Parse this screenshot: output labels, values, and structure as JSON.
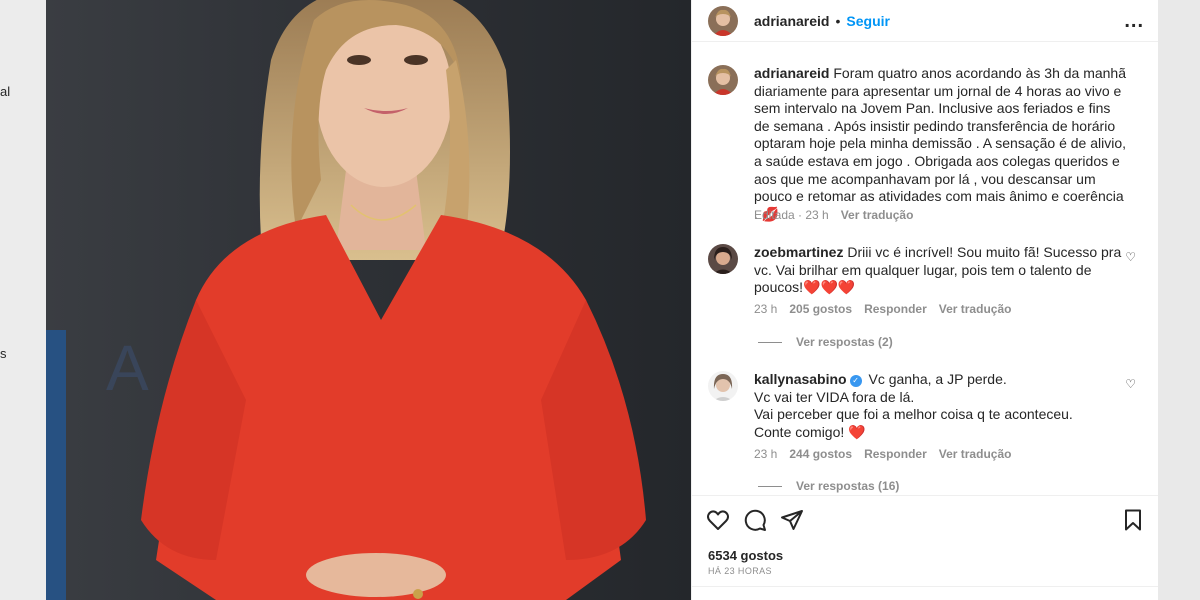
{
  "gutter_left": {
    "frag1": "al",
    "frag2": "s"
  },
  "photo": {
    "background_text": "A"
  },
  "post_header": {
    "username": "adrianareid",
    "separator": "•",
    "follow_label": "Seguir",
    "more_label": "..."
  },
  "caption": {
    "username": "adrianareid",
    "text": "Foram quatro anos acordando às 3h da manhã diariamente para apresentar um jornal de 4 horas ao vivo e sem intervalo na Jovem Pan. Inclusive aos feriados e fins de semana . Após insistir pedindo transferência de horário optaram hoje pela minha demissão . A sensação é de alivio, a saúde estava em jogo . Obrigada aos colegas queridos e aos que me acompanhavam por lá , vou descansar um pouco e retomar as atividades com mais ânimo e coerência .",
    "emoji": "💋",
    "edited": "Editada · 23 h",
    "translate": "Ver tradução"
  },
  "comments": [
    {
      "username": "zoebmartinez",
      "text": "Driii vc é incrível! Sou muito fã! Sucesso pra vc. Vai brilhar em qualquer lugar, pois tem o talento de poucos!",
      "emoji": "❤️❤️❤️",
      "time": "23 h",
      "likes": "205 gostos",
      "reply": "Responder",
      "translate": "Ver tradução",
      "view_replies": "Ver respostas (2)"
    },
    {
      "username": "kallynasabino",
      "verified": "✓",
      "lines": [
        "Vc ganha, a JP perde.",
        "Vc vai ter VIDA fora de lá.",
        "Vai perceber que foi a melhor coisa q te aconteceu.",
        "Conte comigo!"
      ],
      "emoji": "❤️",
      "time": "23 h",
      "likes": "244 gostos",
      "reply": "Responder",
      "translate": "Ver tradução",
      "view_replies": "Ver respostas (16)"
    }
  ],
  "actions": {
    "like_icon": "heart-icon",
    "comment_icon": "comment-icon",
    "share_icon": "send-icon",
    "save_icon": "bookmark-icon",
    "likes_count": "6534 gostos",
    "time_ago": "HÁ 23 HORAS"
  },
  "colors": {
    "accent": "#0095f6",
    "text": "#262626",
    "muted": "#8e8e8e",
    "shirt": "#e23c2a"
  }
}
